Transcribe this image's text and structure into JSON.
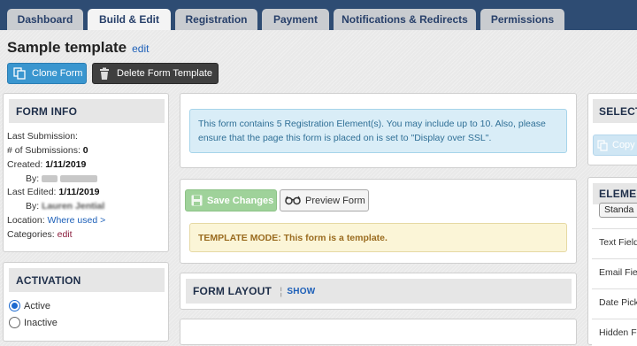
{
  "tabs": [
    "Dashboard",
    "Build & Edit",
    "Registration",
    "Payment",
    "Notifications & Redirects",
    "Permissions"
  ],
  "header": {
    "title": "Sample template",
    "edit_link": "edit"
  },
  "toolbar": {
    "clone_label": "Clone Form",
    "delete_label": "Delete Form Template"
  },
  "form_info": {
    "heading": "FORM INFO",
    "last_submission_label": "Last Submission:",
    "submissions_label": "# of Submissions:",
    "submissions_value": "0",
    "created_label": "Created:",
    "created_value": "1/11/2019",
    "by_label": "By:",
    "last_edited_label": "Last Edited:",
    "last_edited_value": "1/11/2019",
    "by2_label": "By:",
    "by2_value_partial": "Lauren Jential",
    "location_label": "Location:",
    "location_link": "Where used >",
    "categories_label": "Categories:",
    "categories_link": "edit"
  },
  "activation": {
    "heading": "ACTIVATION",
    "options": [
      "Active",
      "Inactive"
    ],
    "selected": "Active"
  },
  "notice": {
    "text": "This form contains 5 Registration Element(s). You may include up to 10. Also, please ensure that the page this form is placed on is set to \"Display over SSL\"."
  },
  "actions": {
    "save_label": "Save Changes",
    "preview_label": "Preview Form"
  },
  "template_warning": "TEMPLATE MODE: This form is a template.",
  "form_layout": {
    "heading": "FORM LAYOUT",
    "toggle": "SHOW"
  },
  "right": {
    "select_heading": "SELECT",
    "copy_label": "Copy",
    "elements_heading": "ELEME",
    "standard_label": "Standa",
    "items": [
      "Text Field",
      "Email Fie",
      "Date Pick",
      "Hidden F"
    ]
  },
  "colors": {
    "nav": "#2e4c73",
    "link": "#1c5fb8",
    "clone": "#3a96cf",
    "notice_bg": "#d9edf7",
    "warn_bg": "#fbf5d7",
    "save": "#9fd29a"
  }
}
